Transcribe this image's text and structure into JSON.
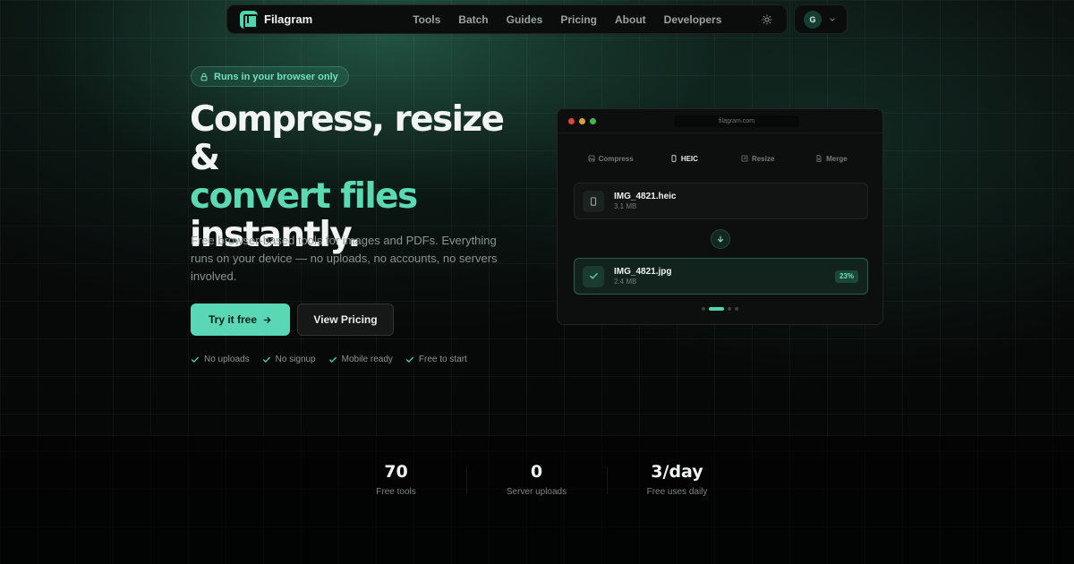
{
  "nav": {
    "brand": "Filagram",
    "links": [
      "Tools",
      "Batch",
      "Guides",
      "Pricing",
      "About",
      "Developers"
    ],
    "theme_icon": "sun-icon",
    "avatar_initial": "G"
  },
  "hero": {
    "badge": "Runs in your browser only",
    "headline_line1": "Compress, resize &",
    "headline_line2": "convert files",
    "headline_line3": "instantly.",
    "subtitle": "Free browser-based tools for images and PDFs. Everything runs on your device — no uploads, no accounts, no servers involved.",
    "primary_cta": "Try it free",
    "secondary_cta": "View Pricing",
    "checks": [
      "No uploads",
      "No signup",
      "Mobile ready",
      "Free to start"
    ]
  },
  "demo": {
    "url": "filagram.com",
    "tabs": [
      {
        "label": "Compress",
        "icon": "image-icon"
      },
      {
        "label": "HEIC",
        "icon": "phone-icon"
      },
      {
        "label": "Resize",
        "icon": "resize-icon"
      },
      {
        "label": "Merge",
        "icon": "document-icon"
      }
    ],
    "active_tab": "HEIC",
    "input_file": {
      "name": "IMG_4821.heic",
      "size": "3.1 MB"
    },
    "output_file": {
      "name": "IMG_4821.jpg",
      "size": "2.4 MB",
      "reduction": "23%"
    },
    "slide_count": 4,
    "active_slide": 2
  },
  "stats": [
    {
      "value": "70",
      "label": "Free tools"
    },
    {
      "value": "0",
      "label": "Server uploads"
    },
    {
      "value": "3/day",
      "label": "Free uses daily"
    }
  ],
  "colors": {
    "accent": "#5ad7b5",
    "background": "#070909",
    "traffic_red": "#e0443a",
    "traffic_yellow": "#d9a23a",
    "traffic_green": "#3fb950"
  }
}
